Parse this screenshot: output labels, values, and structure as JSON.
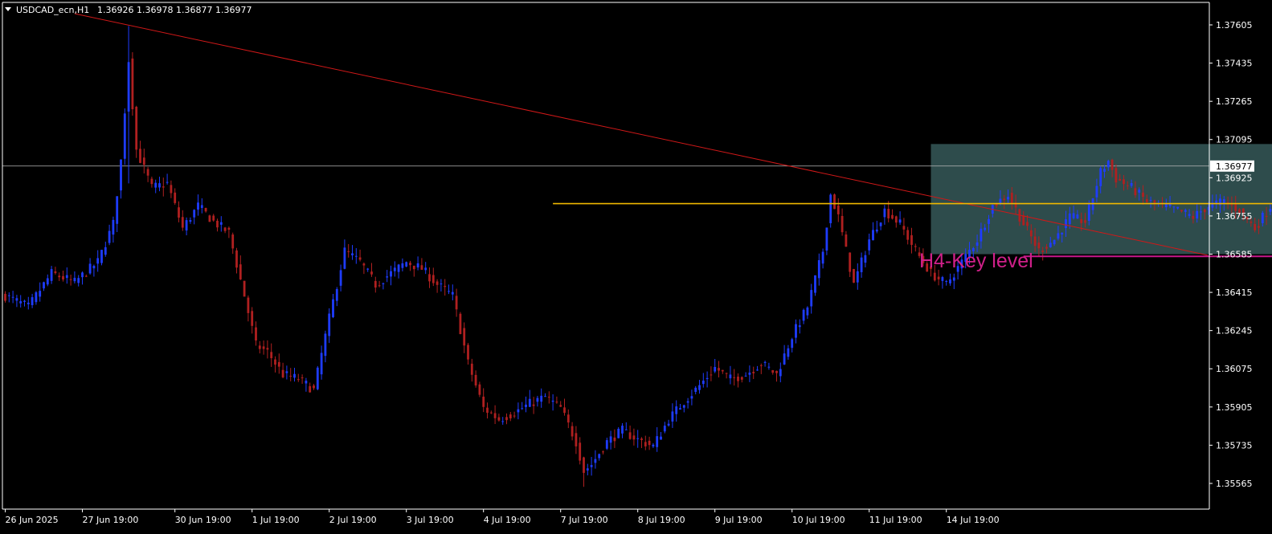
{
  "header": {
    "symbol_timeframe": "USDCAD_ecn,H1",
    "ohlc": "1.36926 1.36978 1.36877 1.36977"
  },
  "current_price_label": "1.36977",
  "annotation_label": "H4-Key level",
  "colors": {
    "background": "#000000",
    "bull": "#1e3cff",
    "bear": "#b02020",
    "axis": "#ffffff",
    "trendline": "#d01818",
    "key_level": "#f0b800",
    "zone_fill": "#2e4c4c",
    "zone_bottom_line": "#c8188c",
    "top_line": "#e01818",
    "zigzag": "#ffff20",
    "annotation_text": "#d0208a"
  },
  "chart_data": {
    "type": "candlestick",
    "symbol": "USDCAD_ecn",
    "timeframe": "H1",
    "y_ticks": [
      "1.37605",
      "1.37435",
      "1.37265",
      "1.37095",
      "1.36925",
      "1.36755",
      "1.36585",
      "1.36415",
      "1.36245",
      "1.36075",
      "1.35905",
      "1.35735",
      "1.35565"
    ],
    "x_ticks": [
      "26 Jun 2025",
      "27 Jun 19:00",
      "30 Jun 19:00",
      "1 Jul 19:00",
      "2 Jul 19:00",
      "3 Jul 19:00",
      "4 Jul 19:00",
      "7 Jul 19:00",
      "8 Jul 19:00",
      "9 Jul 19:00",
      "10 Jul 19:00",
      "11 Jul 19:00",
      "14 Jul 19:00"
    ],
    "ylim": [
      1.3551,
      1.3771
    ],
    "current_price": 1.36977,
    "anchors": [
      [
        0,
        1.364
      ],
      [
        6,
        1.3635
      ],
      [
        12,
        1.365
      ],
      [
        18,
        1.3646
      ],
      [
        24,
        1.3655
      ],
      [
        28,
        1.3672
      ],
      [
        30,
        1.37
      ],
      [
        32,
        1.3745
      ],
      [
        34,
        1.3705
      ],
      [
        38,
        1.3688
      ],
      [
        42,
        1.369
      ],
      [
        46,
        1.367
      ],
      [
        50,
        1.368
      ],
      [
        54,
        1.3673
      ],
      [
        58,
        1.3668
      ],
      [
        62,
        1.364
      ],
      [
        65,
        1.3618
      ],
      [
        68,
        1.3615
      ],
      [
        72,
        1.3605
      ],
      [
        76,
        1.3603
      ],
      [
        80,
        1.3598
      ],
      [
        84,
        1.363
      ],
      [
        88,
        1.366
      ],
      [
        92,
        1.3655
      ],
      [
        96,
        1.3645
      ],
      [
        100,
        1.365
      ],
      [
        104,
        1.3655
      ],
      [
        108,
        1.3652
      ],
      [
        112,
        1.3645
      ],
      [
        116,
        1.364
      ],
      [
        120,
        1.361
      ],
      [
        124,
        1.359
      ],
      [
        128,
        1.3585
      ],
      [
        132,
        1.3588
      ],
      [
        136,
        1.3592
      ],
      [
        140,
        1.3595
      ],
      [
        144,
        1.359
      ],
      [
        148,
        1.3575
      ],
      [
        150,
        1.3562
      ],
      [
        152,
        1.3565
      ],
      [
        156,
        1.3575
      ],
      [
        160,
        1.358
      ],
      [
        164,
        1.3576
      ],
      [
        168,
        1.3573
      ],
      [
        172,
        1.3585
      ],
      [
        176,
        1.3593
      ],
      [
        180,
        1.36
      ],
      [
        184,
        1.3608
      ],
      [
        188,
        1.3603
      ],
      [
        192,
        1.3605
      ],
      [
        196,
        1.361
      ],
      [
        200,
        1.3605
      ],
      [
        204,
        1.3622
      ],
      [
        208,
        1.3635
      ],
      [
        212,
        1.366
      ],
      [
        214,
        1.3685
      ],
      [
        216,
        1.3675
      ],
      [
        218,
        1.366
      ],
      [
        220,
        1.3645
      ],
      [
        224,
        1.3665
      ],
      [
        228,
        1.3678
      ],
      [
        232,
        1.3672
      ],
      [
        236,
        1.366
      ],
      [
        240,
        1.365
      ],
      [
        244,
        1.3645
      ],
      [
        248,
        1.3655
      ],
      [
        252,
        1.3665
      ],
      [
        256,
        1.368
      ],
      [
        260,
        1.3685
      ],
      [
        264,
        1.3672
      ],
      [
        268,
        1.366
      ],
      [
        272,
        1.3665
      ],
      [
        276,
        1.3675
      ],
      [
        280,
        1.3673
      ],
      [
        284,
        1.3695
      ],
      [
        286,
        1.37
      ],
      [
        288,
        1.3692
      ],
      [
        292,
        1.3688
      ],
      [
        296,
        1.3682
      ],
      [
        300,
        1.368
      ],
      [
        304,
        1.3678
      ],
      [
        308,
        1.3675
      ],
      [
        312,
        1.368
      ],
      [
        316,
        1.3682
      ],
      [
        320,
        1.3678
      ],
      [
        324,
        1.367
      ],
      [
        328,
        1.368
      ],
      [
        332,
        1.3695
      ],
      [
        336,
        1.3688
      ],
      [
        340,
        1.3682
      ],
      [
        344,
        1.3672
      ],
      [
        346,
        1.3665
      ],
      [
        348,
        1.3675
      ],
      [
        349,
        1.3692
      ],
      [
        352,
        1.3695
      ],
      [
        356,
        1.3693
      ],
      [
        360,
        1.369
      ],
      [
        364,
        1.3685
      ],
      [
        368,
        1.368
      ],
      [
        372,
        1.369
      ],
      [
        376,
        1.3688
      ],
      [
        380,
        1.3683
      ],
      [
        384,
        1.368
      ],
      [
        388,
        1.3682
      ],
      [
        392,
        1.3675
      ],
      [
        396,
        1.3685
      ],
      [
        400,
        1.3698
      ],
      [
        404,
        1.37
      ],
      [
        408,
        1.3703
      ],
      [
        411,
        1.3702
      ],
      [
        414,
        1.3693
      ],
      [
        417,
        1.3698
      ]
    ],
    "overlays": {
      "trendline": {
        "from": [
          18,
          1.37655
        ],
        "to": [
          427,
          1.3658
        ]
      },
      "key_level": {
        "from": [
          142,
          1.3681
        ],
        "to": [
          423,
          1.3681
        ],
        "value": 1.3681
      },
      "zone": {
        "x0": 240,
        "x1": 386,
        "y_top": 1.37075,
        "y_bottom": 1.36585
      },
      "zone_bottom_line": {
        "from": [
          264,
          1.36575
        ],
        "to": [
          391,
          1.36575
        ]
      },
      "top_line": {
        "from": [
          363,
          1.37085
        ],
        "to": [
          403,
          1.37085
        ]
      },
      "zigzag": [
        [
          360,
          1.3675
        ],
        [
          376,
          1.37088
        ],
        [
          385,
          1.36905
        ]
      ]
    }
  }
}
